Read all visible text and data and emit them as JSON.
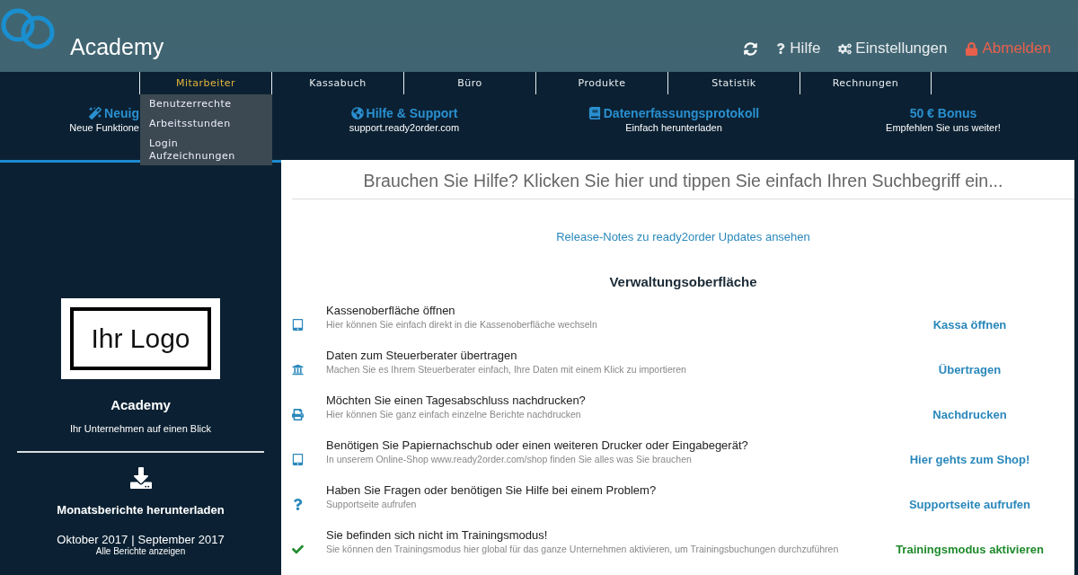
{
  "header": {
    "title": "Academy",
    "actions": [
      {
        "kind": "refresh"
      },
      {
        "kind": "help",
        "label": "Hilfe"
      },
      {
        "kind": "settings",
        "label": "Einstellungen"
      },
      {
        "kind": "logout",
        "label": "Abmelden"
      }
    ]
  },
  "nav": [
    {
      "label": "Mitarbeiter",
      "selected": true,
      "menu": [
        "Benutzerrechte",
        "Arbeitsstunden",
        "Login Aufzeichnungen"
      ]
    },
    {
      "label": "Kassabuch",
      "selected": false
    },
    {
      "label": "Büro",
      "selected": false
    },
    {
      "label": "Produkte",
      "selected": false
    },
    {
      "label": "Statistik",
      "selected": false
    },
    {
      "label": "Rechnungen",
      "selected": false
    }
  ],
  "info": [
    {
      "title": "Neuig",
      "text": "Neue Funktione"
    },
    {
      "title": "Hilfe & Support",
      "text": "support.ready2order.com"
    },
    {
      "title": "Datenerfassungsprotokoll",
      "text": "Einfach herunterladen"
    },
    {
      "title": "50 € Bonus",
      "text": "Empfehlen Sie uns weiter!"
    }
  ],
  "sidebar": {
    "logo": "Ihr Logo",
    "company": "Academy",
    "tagline": "Ihr Unternehmen auf einen Blick",
    "reports_title": "Monatsberichte herunterladen",
    "months": [
      "Oktober 2017",
      "September 2017"
    ],
    "separator": "|",
    "all_reports": "Alle Berichte anzeigen"
  },
  "main": {
    "search_prompt": "Brauchen Sie Hilfe? Klicken Sie hier und tippen Sie einfach Ihren Suchbegriff ein...",
    "release_notes": "Release-Notes zu ready2order Updates ansehen",
    "heading": "Verwaltungsoberfläche",
    "rows": [
      {
        "title": "Kassenoberfläche öffnen",
        "text": "Hier können Sie einfach direkt in die Kassenoberfläche wechseln",
        "action": "Kassa öffnen",
        "color": "#2a88bb"
      },
      {
        "title": "Daten zum Steuerberater übertragen",
        "text": "Machen Sie es Ihrem Steuerberater einfach, Ihre Daten mit einem Klick zu importieren",
        "action": "Übertragen",
        "color": "#2a88bb"
      },
      {
        "title": "Möchten Sie einen Tagesabschluss nachdrucken?",
        "text": "Hier können Sie ganz einfach einzelne Berichte nachdrucken",
        "action": "Nachdrucken",
        "color": "#2a88bb"
      },
      {
        "title": "Benötigen Sie Papiernachschub oder einen weiteren Drucker oder Eingabegerät?",
        "text": "In unserem Online-Shop www.ready2order.com/shop finden Sie alles was Sie brauchen",
        "action": "Hier gehts zum Shop!",
        "color": "#2a88bb"
      },
      {
        "title": "Haben Sie Fragen oder benötigen Sie Hilfe bei einem Problem?",
        "text": "Supportseite aufrufen",
        "action": "Supportseite aufrufen",
        "color": "#2a88bb"
      },
      {
        "title": "Sie befinden sich nicht im Trainingsmodus!",
        "text": "Sie können den Trainingsmodus hier global für das ganze Unternehmen aktivieren, um Trainingsbuchungen durchzuführen",
        "action": "Trainingsmodus aktivieren",
        "color": "#1f8a2c"
      }
    ]
  }
}
